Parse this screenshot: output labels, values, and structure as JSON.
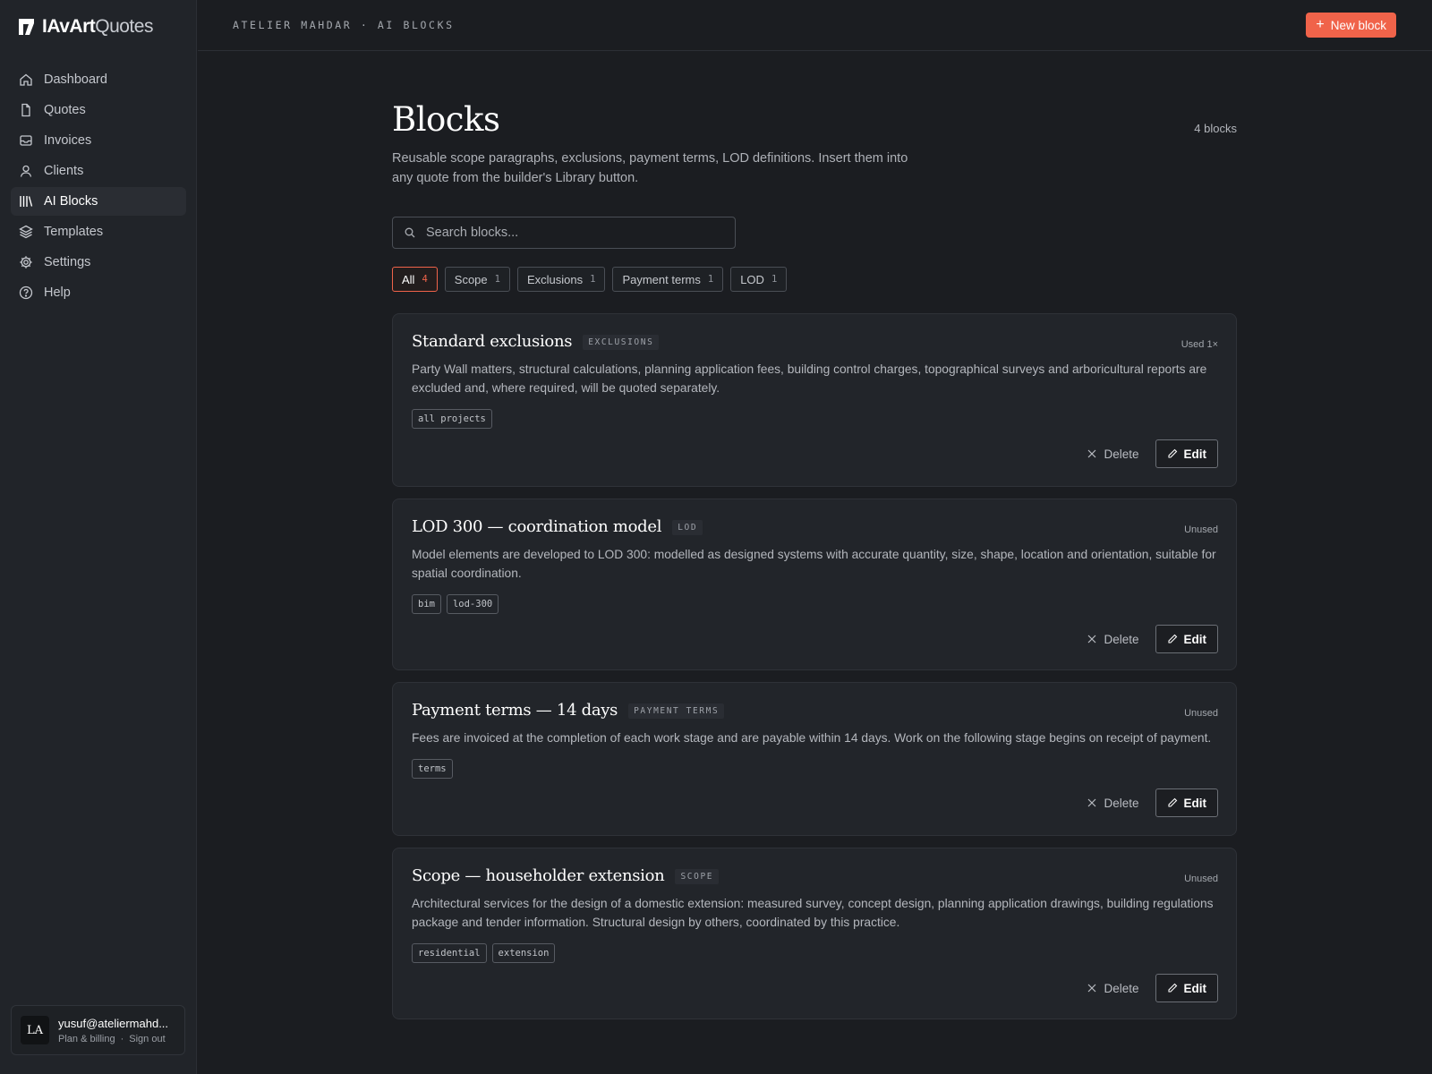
{
  "app": {
    "brand_strong": "IAvArt",
    "brand_light": "Quotes",
    "logo_icon": "logo-mark-icon"
  },
  "sidebar": {
    "items": [
      {
        "label": "Dashboard",
        "icon": "home-icon",
        "active": false
      },
      {
        "label": "Quotes",
        "icon": "file-icon",
        "active": false
      },
      {
        "label": "Invoices",
        "icon": "inbox-icon",
        "active": false
      },
      {
        "label": "Clients",
        "icon": "user-icon",
        "active": false
      },
      {
        "label": "AI Blocks",
        "icon": "library-icon",
        "active": true
      },
      {
        "label": "Templates",
        "icon": "layers-icon",
        "active": false
      },
      {
        "label": "Settings",
        "icon": "gear-icon",
        "active": false
      },
      {
        "label": "Help",
        "icon": "help-circle-icon",
        "active": false
      }
    ],
    "account": {
      "initials": "LA",
      "email": "yusuf@ateliermahd...",
      "plan_link": "Plan & billing",
      "separator": "·",
      "signout_link": "Sign out"
    }
  },
  "topbar": {
    "breadcrumb": "ATELIER MAHDAR · AI BLOCKS",
    "new_button": "New block"
  },
  "main": {
    "title": "Blocks",
    "count": "4 blocks",
    "subtitle": "Reusable scope paragraphs, exclusions, payment terms, LOD definitions. Insert them into any quote from the builder's Library button.",
    "search_placeholder": "Search blocks...",
    "filters": [
      {
        "label": "All",
        "count": "4",
        "active": true
      },
      {
        "label": "Scope",
        "count": "1",
        "active": false
      },
      {
        "label": "Exclusions",
        "count": "1",
        "active": false
      },
      {
        "label": "Payment terms",
        "count": "1",
        "active": false
      },
      {
        "label": "LOD",
        "count": "1",
        "active": false
      }
    ],
    "blocks": [
      {
        "title": "Standard exclusions",
        "category": "EXCLUSIONS",
        "usage": "Used 1×",
        "body": "Party Wall matters, structural calculations, planning application fees, building control charges, topographical surveys and arboricultural reports are excluded and, where required, will be quoted separately.",
        "tags": [
          "all projects"
        ],
        "delete_label": "Delete",
        "edit_label": "Edit"
      },
      {
        "title": "LOD 300 — coordination model",
        "category": "LOD",
        "usage": "Unused",
        "body": "Model elements are developed to LOD 300: modelled as designed systems with accurate quantity, size, shape, location and orientation, suitable for spatial coordination.",
        "tags": [
          "bim",
          "lod-300"
        ],
        "delete_label": "Delete",
        "edit_label": "Edit"
      },
      {
        "title": "Payment terms — 14 days",
        "category": "PAYMENT TERMS",
        "usage": "Unused",
        "body": "Fees are invoiced at the completion of each work stage and are payable within 14 days. Work on the following stage begins on receipt of payment.",
        "tags": [
          "terms"
        ],
        "delete_label": "Delete",
        "edit_label": "Edit"
      },
      {
        "title": "Scope — householder extension",
        "category": "SCOPE",
        "usage": "Unused",
        "body": "Architectural services for the design of a domestic extension: measured survey, concept design, planning application drawings, building regulations package and tender information. Structural design by others, coordinated by this practice.",
        "tags": [
          "residential",
          "extension"
        ],
        "delete_label": "Delete",
        "edit_label": "Edit"
      }
    ]
  },
  "colors": {
    "accent": "#f0634a",
    "background": "#1b1d21",
    "sidebar": "#212429",
    "card": "#22252a"
  }
}
